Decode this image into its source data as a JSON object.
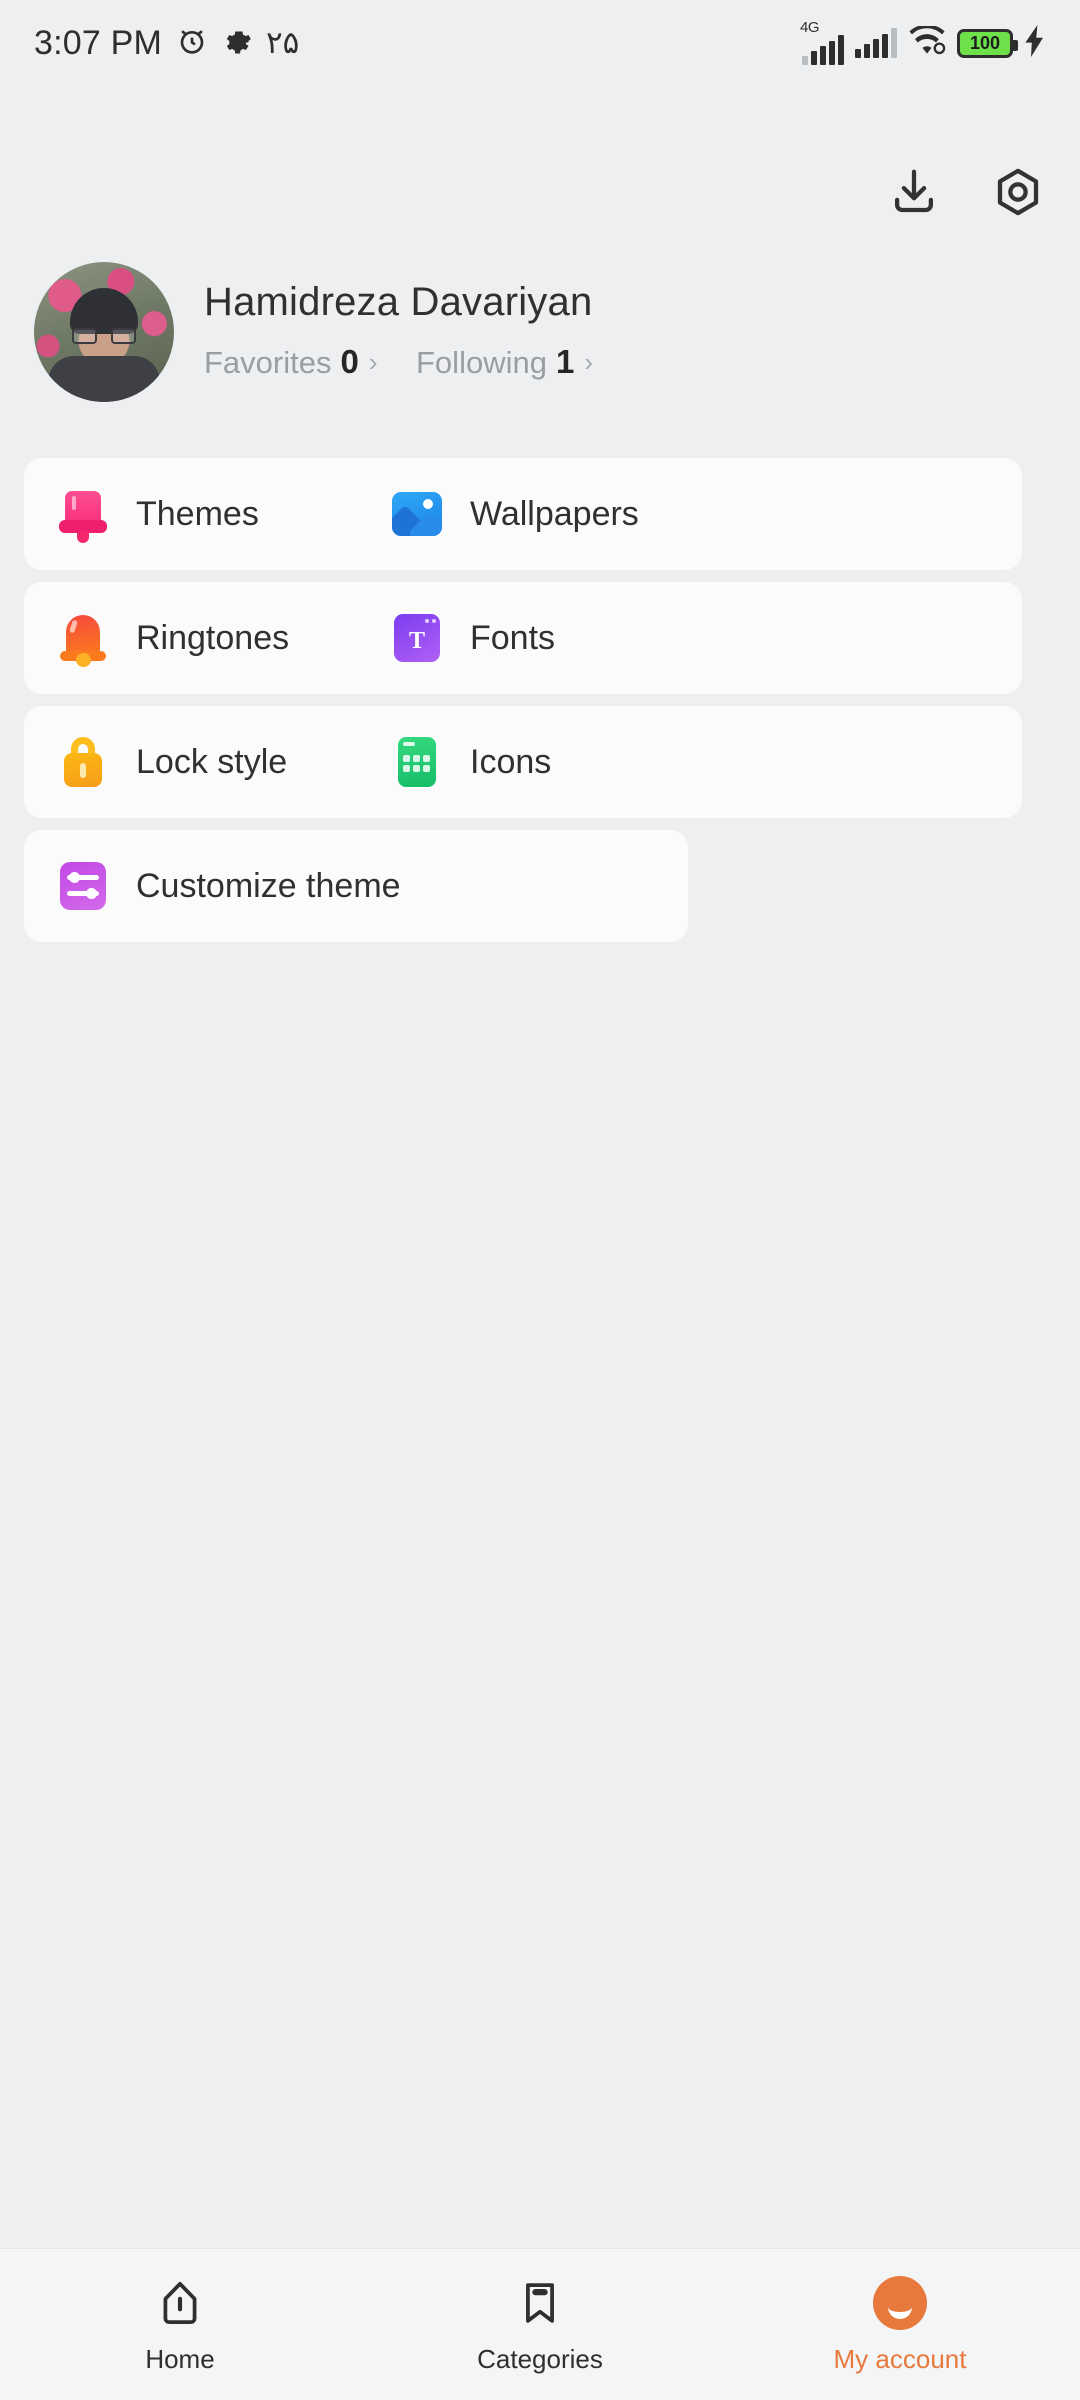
{
  "status_bar": {
    "time": "3:07 PM",
    "alarm_icon": "alarm-clock-icon",
    "settings_icon": "gear-icon",
    "notification_count": "۲۵",
    "network_label": "4G",
    "battery_level": "100",
    "charging_icon": "charging-bolt-icon",
    "wifi_icon": "wifi-icon"
  },
  "top_actions": {
    "download_label": "download-icon",
    "settings_label": "settings-hex-icon"
  },
  "profile": {
    "name": "Hamidreza Davariyan",
    "avatar_alt": "user-avatar",
    "stats": [
      {
        "label": "Favorites",
        "value": "0",
        "chevron": "›"
      },
      {
        "label": "Following",
        "value": "1",
        "chevron": "›"
      }
    ]
  },
  "grid": {
    "items": [
      {
        "label": "Themes",
        "icon": "paintbrush-icon",
        "color": "#f5287a"
      },
      {
        "label": "Wallpapers",
        "icon": "image-icon",
        "color": "#2291ee"
      },
      {
        "label": "Ringtones",
        "icon": "bell-icon",
        "color": "#f86a2a"
      },
      {
        "label": "Fonts",
        "icon": "font-t-icon",
        "color": "#9a4ef2"
      },
      {
        "label": "Lock style",
        "icon": "lock-icon",
        "color": "#fab015"
      },
      {
        "label": "Icons",
        "icon": "app-grid-icon",
        "color": "#24cb74"
      },
      {
        "label": "Customize theme",
        "icon": "sliders-icon",
        "color": "#cb55e8"
      }
    ]
  },
  "bottom_nav": {
    "active_color": "#e8793c",
    "items": [
      {
        "label": "Home",
        "icon": "home-icon",
        "active": false
      },
      {
        "label": "Categories",
        "icon": "bookmark-icon",
        "active": false
      },
      {
        "label": "My account",
        "icon": "account-smiley-icon",
        "active": true
      }
    ]
  }
}
